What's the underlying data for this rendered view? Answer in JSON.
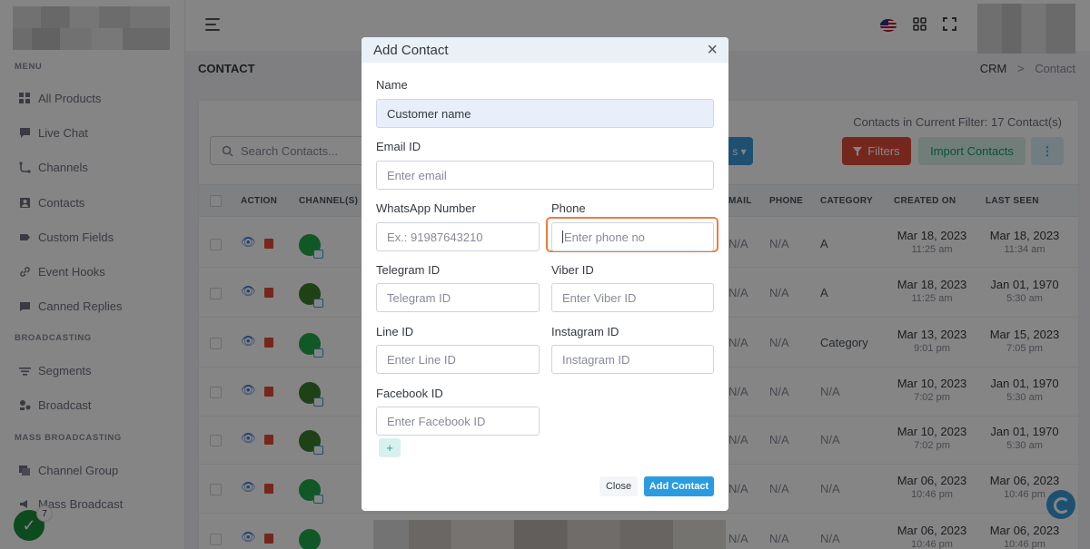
{
  "sidebar": {
    "sections": [
      {
        "title": "MENU"
      },
      {
        "title": "BROADCASTING"
      },
      {
        "title": "MASS BROADCASTING"
      }
    ],
    "items": [
      {
        "label": "All Products",
        "icon": "grid-icon"
      },
      {
        "label": "Live Chat",
        "icon": "chat-icon"
      },
      {
        "label": "Channels",
        "icon": "channels-icon"
      },
      {
        "label": "Contacts",
        "icon": "contacts-icon"
      },
      {
        "label": "Custom Fields",
        "icon": "tag-icon"
      },
      {
        "label": "Event Hooks",
        "icon": "link-icon"
      },
      {
        "label": "Canned Replies",
        "icon": "message-icon"
      },
      {
        "label": "Segments",
        "icon": "segments-icon"
      },
      {
        "label": "Broadcast",
        "icon": "broadcast-icon"
      },
      {
        "label": "Channel Group",
        "icon": "group-icon"
      },
      {
        "label": "Mass Broadcast",
        "icon": "mass-broadcast-icon"
      }
    ]
  },
  "header": {
    "page_title": "CONTACT",
    "breadcrumb": {
      "root": "CRM",
      "separator": ">",
      "current": "Contact"
    }
  },
  "toolbar": {
    "search_placeholder": "Search Contacts...",
    "filter_count": "Contacts in Current Filter: 17 Contact(s)",
    "filters_label": "Filters",
    "import_label": "Import Contacts",
    "more_label": "⋮"
  },
  "table": {
    "columns": [
      "ACTION",
      "CHANNEL(S)",
      "MAIL",
      "PHONE",
      "CATEGORY",
      "CREATED ON",
      "LAST SEEN"
    ],
    "rows": [
      {
        "mail": "N/A",
        "phone": "N/A",
        "category": "A",
        "created": "Mar 18, 2023",
        "created_time": "11:25 am",
        "seen": "Mar 18, 2023",
        "seen_time": "11:34 am"
      },
      {
        "mail": "N/A",
        "phone": "N/A",
        "category": "A",
        "created": "Mar 18, 2023",
        "created_time": "11:25 am",
        "seen": "Jan 01, 1970",
        "seen_time": "5:30 am"
      },
      {
        "mail": "N/A",
        "phone": "N/A",
        "category": "Category",
        "created": "Mar 13, 2023",
        "created_time": "9:01 pm",
        "seen": "Mar 15, 2023",
        "seen_time": "7:05 pm"
      },
      {
        "mail": "N/A",
        "phone": "N/A",
        "category": "N/A",
        "created": "Mar 10, 2023",
        "created_time": "7:02 pm",
        "seen": "Jan 01, 1970",
        "seen_time": "5:30 am"
      },
      {
        "mail": "N/A",
        "phone": "N/A",
        "category": "N/A",
        "created": "Mar 10, 2023",
        "created_time": "7:02 pm",
        "seen": "Jan 01, 1970",
        "seen_time": "5:30 am"
      },
      {
        "mail": "N/A",
        "phone": "N/A",
        "category": "N/A",
        "created": "Mar 06, 2023",
        "created_time": "10:46 pm",
        "seen": "Mar 06, 2023",
        "seen_time": "10:46 pm"
      },
      {
        "mail": "N/A",
        "phone": "N/A",
        "category": "N/A",
        "created": "Mar 06, 2023",
        "created_time": "10:46 pm",
        "seen": "Mar 06, 2023",
        "seen_time": "10:46 pm"
      }
    ]
  },
  "modal": {
    "title": "Add Contact",
    "close_icon": "×",
    "fields": {
      "name": {
        "label": "Name",
        "value": "Customer name"
      },
      "email": {
        "label": "Email ID",
        "placeholder": "Enter email"
      },
      "whatsapp": {
        "label": "WhatsApp Number",
        "placeholder": "Ex.: 91987643210"
      },
      "phone": {
        "label": "Phone",
        "placeholder": "Enter phone no"
      },
      "telegram": {
        "label": "Telegram ID",
        "placeholder": "Telegram ID"
      },
      "viber": {
        "label": "Viber ID",
        "placeholder": "Enter Viber ID"
      },
      "line": {
        "label": "Line ID",
        "placeholder": "Enter Line ID"
      },
      "instagram": {
        "label": "Instagram ID",
        "placeholder": "Instagram ID"
      },
      "facebook": {
        "label": "Facebook ID",
        "placeholder": "Enter Facebook ID"
      }
    },
    "add_field_label": "+",
    "close_button": "Close",
    "submit_button": "Add Contact"
  },
  "notifications": {
    "badge_count": "7"
  },
  "colors": {
    "accent": "#2a9be1",
    "danger": "#e14b3b",
    "success": "#1faa4a",
    "focus": "#f07b3f"
  }
}
